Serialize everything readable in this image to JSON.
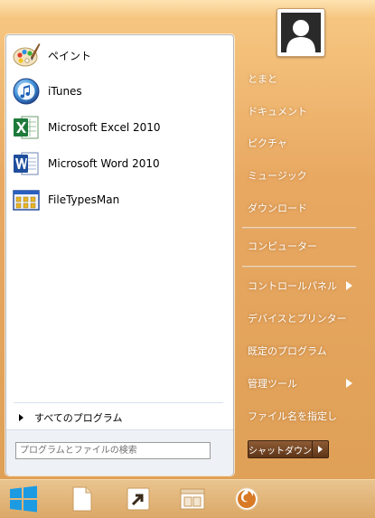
{
  "programs": [
    {
      "label": "ペイント",
      "icon": "paint-icon"
    },
    {
      "label": "iTunes",
      "icon": "itunes-icon"
    },
    {
      "label": "Microsoft Excel 2010",
      "icon": "excel-icon"
    },
    {
      "label": "Microsoft Word 2010",
      "icon": "word-icon"
    },
    {
      "label": "FileTypesMan",
      "icon": "filetypesman-icon"
    }
  ],
  "all_programs_label": "すべてのプログラム",
  "search": {
    "placeholder": "プログラムとファイルの検索",
    "value": ""
  },
  "user": {
    "avatar_icon": "user-avatar-icon"
  },
  "right_links": [
    {
      "label": "とまと",
      "has_submenu": false
    },
    {
      "label": "ドキュメント",
      "has_submenu": false
    },
    {
      "label": "ピクチャ",
      "has_submenu": false
    },
    {
      "label": "ミュージック",
      "has_submenu": false
    },
    {
      "label": "ダウンロード",
      "has_submenu": false
    },
    {
      "label": "コンピューター",
      "has_submenu": false
    },
    {
      "label": "コントロールパネル",
      "has_submenu": true
    },
    {
      "label": "デバイスとプリンター",
      "has_submenu": false
    },
    {
      "label": "既定のプログラム",
      "has_submenu": false
    },
    {
      "label": "管理ツール",
      "has_submenu": true
    },
    {
      "label": "ファイル名を指定し",
      "has_submenu": false
    }
  ],
  "shutdown_label": "シャットダウン",
  "taskbar": {
    "items": [
      "start-button-icon",
      "document-icon",
      "shortcut-icon",
      "window-icon",
      "firefox-icon"
    ]
  },
  "colors": {
    "menu_background": "#e8a862",
    "taskbar_background": "#dba867",
    "shutdown_button": "#6e4222",
    "start_logo": "#1c9be3"
  }
}
